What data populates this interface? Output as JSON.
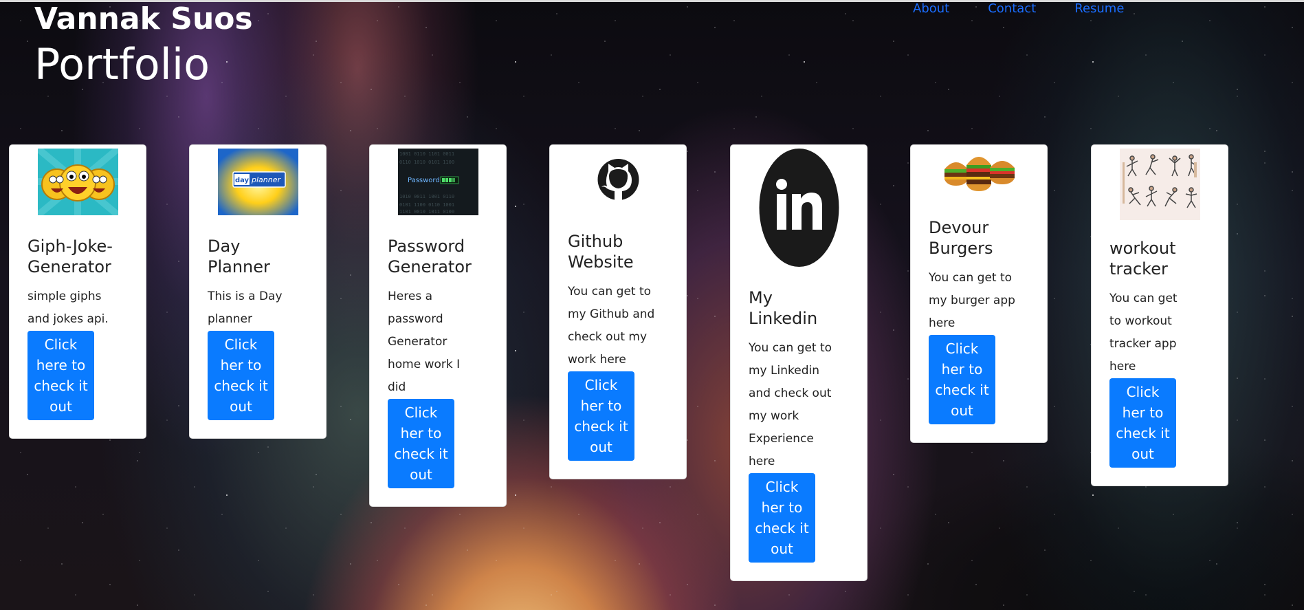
{
  "header": {
    "name": "Vannak Suos",
    "title": "Portfolio"
  },
  "nav": {
    "items": [
      "About",
      "Contact",
      "Resume"
    ]
  },
  "cards": [
    {
      "title": "Giph-Joke-Generator",
      "text": "simple giphs and jokes api.",
      "button": "Click here to check it out",
      "icon": "laughing-emoji-icon"
    },
    {
      "title": "Day Planner",
      "text": "This is a Day planner",
      "button": "Click her to check it out",
      "icon": "day-planner-icon"
    },
    {
      "title": "Password Generator",
      "text": "Heres a password Generator home work I did",
      "button": "Click her to check it out",
      "icon": "password-icon"
    },
    {
      "title": "Github Website",
      "text": "You can get to my Github and check out my work here",
      "button": "Click her to check it out",
      "icon": "github-icon"
    },
    {
      "title": "My Linkedin",
      "text": "You can get to my Linkedin and check out my work Experience here",
      "button": "Click her to check it out",
      "icon": "linkedin-icon"
    },
    {
      "title": "Devour Burgers",
      "text": "You can get to my burger app here",
      "button": "Click her to check it out",
      "icon": "burger-icon"
    },
    {
      "title": "workout tracker",
      "text": "You can get to workout tracker app here",
      "button": "Click her to check it out",
      "icon": "workout-icon"
    }
  ],
  "colors": {
    "button": "#0a7bff",
    "nav_link": "#1a6dff"
  }
}
